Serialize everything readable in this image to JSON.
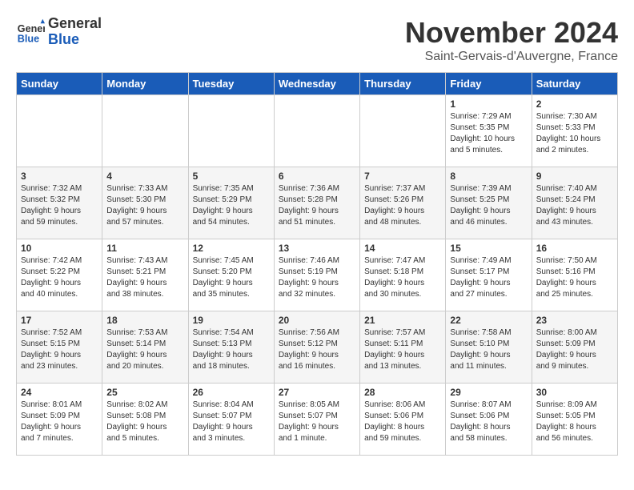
{
  "logo": {
    "line1": "General",
    "line2": "Blue"
  },
  "header": {
    "month": "November 2024",
    "location": "Saint-Gervais-d'Auvergne, France"
  },
  "weekdays": [
    "Sunday",
    "Monday",
    "Tuesday",
    "Wednesday",
    "Thursday",
    "Friday",
    "Saturday"
  ],
  "weeks": [
    [
      {
        "day": "",
        "info": ""
      },
      {
        "day": "",
        "info": ""
      },
      {
        "day": "",
        "info": ""
      },
      {
        "day": "",
        "info": ""
      },
      {
        "day": "",
        "info": ""
      },
      {
        "day": "1",
        "info": "Sunrise: 7:29 AM\nSunset: 5:35 PM\nDaylight: 10 hours\nand 5 minutes."
      },
      {
        "day": "2",
        "info": "Sunrise: 7:30 AM\nSunset: 5:33 PM\nDaylight: 10 hours\nand 2 minutes."
      }
    ],
    [
      {
        "day": "3",
        "info": "Sunrise: 7:32 AM\nSunset: 5:32 PM\nDaylight: 9 hours\nand 59 minutes."
      },
      {
        "day": "4",
        "info": "Sunrise: 7:33 AM\nSunset: 5:30 PM\nDaylight: 9 hours\nand 57 minutes."
      },
      {
        "day": "5",
        "info": "Sunrise: 7:35 AM\nSunset: 5:29 PM\nDaylight: 9 hours\nand 54 minutes."
      },
      {
        "day": "6",
        "info": "Sunrise: 7:36 AM\nSunset: 5:28 PM\nDaylight: 9 hours\nand 51 minutes."
      },
      {
        "day": "7",
        "info": "Sunrise: 7:37 AM\nSunset: 5:26 PM\nDaylight: 9 hours\nand 48 minutes."
      },
      {
        "day": "8",
        "info": "Sunrise: 7:39 AM\nSunset: 5:25 PM\nDaylight: 9 hours\nand 46 minutes."
      },
      {
        "day": "9",
        "info": "Sunrise: 7:40 AM\nSunset: 5:24 PM\nDaylight: 9 hours\nand 43 minutes."
      }
    ],
    [
      {
        "day": "10",
        "info": "Sunrise: 7:42 AM\nSunset: 5:22 PM\nDaylight: 9 hours\nand 40 minutes."
      },
      {
        "day": "11",
        "info": "Sunrise: 7:43 AM\nSunset: 5:21 PM\nDaylight: 9 hours\nand 38 minutes."
      },
      {
        "day": "12",
        "info": "Sunrise: 7:45 AM\nSunset: 5:20 PM\nDaylight: 9 hours\nand 35 minutes."
      },
      {
        "day": "13",
        "info": "Sunrise: 7:46 AM\nSunset: 5:19 PM\nDaylight: 9 hours\nand 32 minutes."
      },
      {
        "day": "14",
        "info": "Sunrise: 7:47 AM\nSunset: 5:18 PM\nDaylight: 9 hours\nand 30 minutes."
      },
      {
        "day": "15",
        "info": "Sunrise: 7:49 AM\nSunset: 5:17 PM\nDaylight: 9 hours\nand 27 minutes."
      },
      {
        "day": "16",
        "info": "Sunrise: 7:50 AM\nSunset: 5:16 PM\nDaylight: 9 hours\nand 25 minutes."
      }
    ],
    [
      {
        "day": "17",
        "info": "Sunrise: 7:52 AM\nSunset: 5:15 PM\nDaylight: 9 hours\nand 23 minutes."
      },
      {
        "day": "18",
        "info": "Sunrise: 7:53 AM\nSunset: 5:14 PM\nDaylight: 9 hours\nand 20 minutes."
      },
      {
        "day": "19",
        "info": "Sunrise: 7:54 AM\nSunset: 5:13 PM\nDaylight: 9 hours\nand 18 minutes."
      },
      {
        "day": "20",
        "info": "Sunrise: 7:56 AM\nSunset: 5:12 PM\nDaylight: 9 hours\nand 16 minutes."
      },
      {
        "day": "21",
        "info": "Sunrise: 7:57 AM\nSunset: 5:11 PM\nDaylight: 9 hours\nand 13 minutes."
      },
      {
        "day": "22",
        "info": "Sunrise: 7:58 AM\nSunset: 5:10 PM\nDaylight: 9 hours\nand 11 minutes."
      },
      {
        "day": "23",
        "info": "Sunrise: 8:00 AM\nSunset: 5:09 PM\nDaylight: 9 hours\nand 9 minutes."
      }
    ],
    [
      {
        "day": "24",
        "info": "Sunrise: 8:01 AM\nSunset: 5:09 PM\nDaylight: 9 hours\nand 7 minutes."
      },
      {
        "day": "25",
        "info": "Sunrise: 8:02 AM\nSunset: 5:08 PM\nDaylight: 9 hours\nand 5 minutes."
      },
      {
        "day": "26",
        "info": "Sunrise: 8:04 AM\nSunset: 5:07 PM\nDaylight: 9 hours\nand 3 minutes."
      },
      {
        "day": "27",
        "info": "Sunrise: 8:05 AM\nSunset: 5:07 PM\nDaylight: 9 hours\nand 1 minute."
      },
      {
        "day": "28",
        "info": "Sunrise: 8:06 AM\nSunset: 5:06 PM\nDaylight: 8 hours\nand 59 minutes."
      },
      {
        "day": "29",
        "info": "Sunrise: 8:07 AM\nSunset: 5:06 PM\nDaylight: 8 hours\nand 58 minutes."
      },
      {
        "day": "30",
        "info": "Sunrise: 8:09 AM\nSunset: 5:05 PM\nDaylight: 8 hours\nand 56 minutes."
      }
    ]
  ]
}
